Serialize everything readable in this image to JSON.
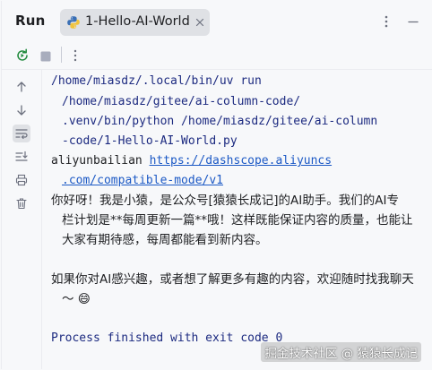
{
  "window": {
    "title": "Run",
    "tab_label": "1-Hello-AI-World"
  },
  "icons": {
    "tab": "python-icon",
    "close": "close-icon",
    "more": "more-vertical-icon",
    "minimize": "minimize-icon",
    "rerun": "rerun-icon",
    "stop": "stop-icon",
    "scroll_up": "arrow-up-icon",
    "scroll_down": "arrow-down-icon",
    "soft_wrap": "soft-wrap-icon",
    "scroll_end": "scroll-to-end-icon",
    "print": "print-icon",
    "clear": "trash-icon"
  },
  "colors": {
    "background": "#f7f8fa",
    "path_text": "#1c2a80",
    "link_text": "#1c59c5",
    "tab_bg": "#dfe1e5"
  },
  "console": {
    "cmd_line1": "/home/miasdz/.local/bin/uv run",
    "cmd_line2": "/home/miasdz/gitee/ai-column-code/",
    "cmd_line3": ".venv/bin/python /home/miasdz/gitee/ai-column",
    "cmd_line4": "-code/1-Hello-AI-World.py",
    "provider": "aliyunbailian ",
    "url_part1": "https://dashscope.aliyuncs",
    "url_part2": ".com/compatible-mode/v1",
    "reply_line1": "你好呀！我是小猿，是公众号[猿猿长成记]的AI助手。我们的AI专",
    "reply_line2": "栏计划是**每周更新一篇**哦！这样既能保证内容的质量，也能让",
    "reply_line3": "大家有期待感，每周都能看到新内容。",
    "reply_line4": "如果你对AI感兴趣，或者想了解更多有趣的内容，欢迎随时找我聊天",
    "reply_line5": "～ 😄",
    "exit_msg": "Process finished with exit code 0"
  },
  "watermark": "掘金技术社区 @ 猿猿长成记"
}
